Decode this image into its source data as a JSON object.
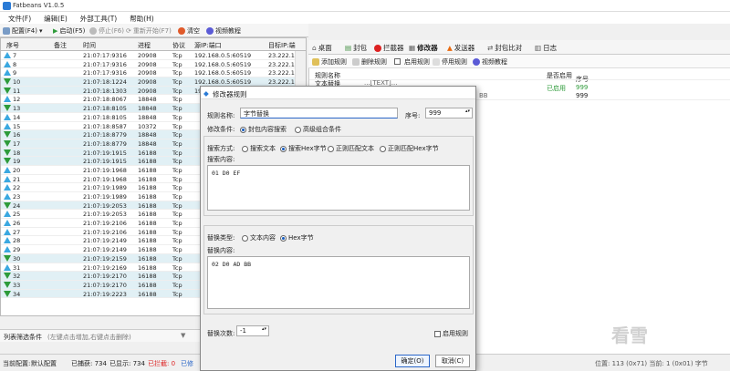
{
  "app": {
    "title": "Fatbeans V1.0.5"
  },
  "menu": [
    "文件(F)",
    "编辑(E)",
    "外部工具(T)",
    "帮助(H)"
  ],
  "toolbar": {
    "config": "配置(F4)",
    "start": "启动(F5)",
    "stop": "停止(F6)",
    "restart": "重新开始(F7)",
    "clear": "清空",
    "tutorial": "视频教程"
  },
  "grid": {
    "headers": [
      "序号",
      "备注",
      "时间",
      "进程",
      "协议",
      "源IP:端口",
      "目标IP:端"
    ],
    "rows": [
      {
        "n": "7",
        "dir": "up",
        "time": "21:07:17:9316",
        "pid": "20908",
        "proto": "Tcp",
        "src": "192.168.0.5:60519",
        "dst": "23.222.16"
      },
      {
        "n": "8",
        "dir": "up",
        "time": "21:07:17:9316",
        "pid": "20908",
        "proto": "Tcp",
        "src": "192.168.0.5:60519",
        "dst": "23.222.16"
      },
      {
        "n": "9",
        "dir": "up",
        "time": "21:07:17:9316",
        "pid": "20908",
        "proto": "Tcp",
        "src": "192.168.0.5:60519",
        "dst": "23.222.16"
      },
      {
        "n": "10",
        "dir": "down",
        "time": "21:07:18:1224",
        "pid": "20908",
        "proto": "Tcp",
        "src": "192.168.0.5:60519",
        "dst": "23.222.16"
      },
      {
        "n": "11",
        "dir": "down",
        "time": "21:07:18:1303",
        "pid": "20908",
        "proto": "Tcp",
        "src": "192.168.0.5:60519",
        "dst": "23.222.16"
      },
      {
        "n": "12",
        "dir": "up",
        "time": "21:07:18:8067",
        "pid": "18848",
        "proto": "Tcp",
        "src": "",
        "dst": ""
      },
      {
        "n": "13",
        "dir": "down",
        "time": "21:07:18:8105",
        "pid": "18848",
        "proto": "Tcp",
        "src": "",
        "dst": ""
      },
      {
        "n": "14",
        "dir": "up",
        "time": "21:07:18:8105",
        "pid": "18848",
        "proto": "Tcp",
        "src": "",
        "dst": ""
      },
      {
        "n": "15",
        "dir": "up",
        "time": "21:07:18:8587",
        "pid": "10372",
        "proto": "Tcp",
        "src": "",
        "dst": ""
      },
      {
        "n": "16",
        "dir": "down",
        "time": "21:07:18:8779",
        "pid": "18848",
        "proto": "Tcp",
        "src": "",
        "dst": ""
      },
      {
        "n": "17",
        "dir": "down",
        "time": "21:07:18:8779",
        "pid": "18848",
        "proto": "Tcp",
        "src": "",
        "dst": ""
      },
      {
        "n": "18",
        "dir": "down",
        "time": "21:07:19:1915",
        "pid": "16188",
        "proto": "Tcp",
        "src": "",
        "dst": ""
      },
      {
        "n": "19",
        "dir": "down",
        "time": "21:07:19:1915",
        "pid": "16188",
        "proto": "Tcp",
        "src": "",
        "dst": ""
      },
      {
        "n": "20",
        "dir": "up",
        "time": "21:07:19:1968",
        "pid": "16188",
        "proto": "Tcp",
        "src": "",
        "dst": ""
      },
      {
        "n": "21",
        "dir": "up",
        "time": "21:07:19:1968",
        "pid": "16188",
        "proto": "Tcp",
        "src": "",
        "dst": ""
      },
      {
        "n": "22",
        "dir": "up",
        "time": "21:07:19:1989",
        "pid": "16188",
        "proto": "Tcp",
        "src": "",
        "dst": ""
      },
      {
        "n": "23",
        "dir": "up",
        "time": "21:07:19:1989",
        "pid": "16188",
        "proto": "Tcp",
        "src": "",
        "dst": ""
      },
      {
        "n": "24",
        "dir": "down",
        "time": "21:07:19:2053",
        "pid": "16188",
        "proto": "Tcp",
        "src": "",
        "dst": ""
      },
      {
        "n": "25",
        "dir": "up",
        "time": "21:07:19:2053",
        "pid": "16188",
        "proto": "Tcp",
        "src": "",
        "dst": ""
      },
      {
        "n": "26",
        "dir": "up",
        "time": "21:07:19:2106",
        "pid": "16188",
        "proto": "Tcp",
        "src": "",
        "dst": ""
      },
      {
        "n": "27",
        "dir": "up",
        "time": "21:07:19:2106",
        "pid": "16188",
        "proto": "Tcp",
        "src": "",
        "dst": ""
      },
      {
        "n": "28",
        "dir": "up",
        "time": "21:07:19:2149",
        "pid": "16188",
        "proto": "Tcp",
        "src": "",
        "dst": ""
      },
      {
        "n": "29",
        "dir": "up",
        "time": "21:07:19:2149",
        "pid": "16188",
        "proto": "Tcp",
        "src": "",
        "dst": ""
      },
      {
        "n": "30",
        "dir": "down",
        "time": "21:07:19:2159",
        "pid": "16188",
        "proto": "Tcp",
        "src": "",
        "dst": ""
      },
      {
        "n": "31",
        "dir": "up",
        "time": "21:07:19:2169",
        "pid": "16188",
        "proto": "Tcp",
        "src": "",
        "dst": ""
      },
      {
        "n": "32",
        "dir": "down",
        "time": "21:07:19:2170",
        "pid": "16188",
        "proto": "Tcp",
        "src": "",
        "dst": ""
      },
      {
        "n": "33",
        "dir": "down",
        "time": "21:07:19:2170",
        "pid": "16188",
        "proto": "Tcp",
        "src": "",
        "dst": ""
      },
      {
        "n": "34",
        "dir": "down",
        "time": "21:07:19:2223",
        "pid": "16188",
        "proto": "Tcp",
        "src": "",
        "dst": ""
      }
    ]
  },
  "filter": {
    "label": "列表筛选条件",
    "hint": "(左键点击增加,右键点击删除)"
  },
  "status": {
    "config": "当前配置:",
    "config_value": "默认配置",
    "captured": "已捕获: 734",
    "shown": "已显示: 734",
    "blocked": "已拦截: 0",
    "modified": "已修",
    "right": "位置: 113 (0x71)  当前: 1 (0x01) 字节"
  },
  "rtabs": [
    "桌面",
    "封包",
    "拦截器",
    "修改器",
    "发送器",
    "封包比对",
    "日志"
  ],
  "rtool": {
    "add": "添加规则",
    "del": "删除规则",
    "enable": "启用规则",
    "disable": "停用规则",
    "tutorial": "视频教程"
  },
  "rgrid": {
    "h_name": "规则名称",
    "h_enabled": "是否启用",
    "h_seq": "序号",
    "row_name": "文本替换",
    "row_content": "...[TEXT]...",
    "row_hex": "BB",
    "row_status": "已启用",
    "row_seq1": "999",
    "row_seq2": "999"
  },
  "dialog": {
    "title": "修改器规则",
    "name_label": "规则名称:",
    "name_value": "字节替换",
    "seq_label": "序号:",
    "seq_value": "999",
    "cond_label": "修改条件:",
    "cond_opt1": "封包内容搜索",
    "cond_opt2": "高级组合条件",
    "search_label": "搜索方式:",
    "search_opts": [
      "搜索文本",
      "搜索Hex字节",
      "正则匹配文本",
      "正则匹配Hex字节"
    ],
    "content_label": "搜索内容:",
    "content_value": "01 D0 EF",
    "replace_type_label": "替换类型:",
    "replace_opts": [
      "文本内容",
      "Hex字节"
    ],
    "replace_label": "替换内容:",
    "replace_value": "02 D0 AD BB",
    "count_label": "替换次数:",
    "count_value": "-1",
    "enable_label": "启用规则",
    "ok": "确定(O)",
    "cancel": "取消(C)"
  },
  "watermark": "看雪"
}
